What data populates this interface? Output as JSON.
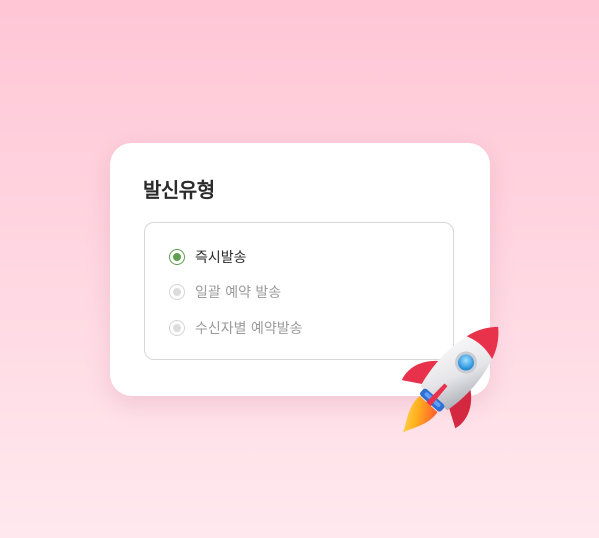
{
  "section": {
    "title": "발신유형"
  },
  "send_type_options": [
    {
      "label": "즉시발송",
      "selected": true
    },
    {
      "label": "일괄 예약 발송",
      "selected": false
    },
    {
      "label": "수신자별 예약발송",
      "selected": false
    }
  ],
  "colors": {
    "accent": "#5fa04e",
    "background_top": "#ffc6d6",
    "background_bottom": "#ffe9ee",
    "card": "#ffffff"
  },
  "decoration": {
    "icon": "rocket-icon"
  }
}
